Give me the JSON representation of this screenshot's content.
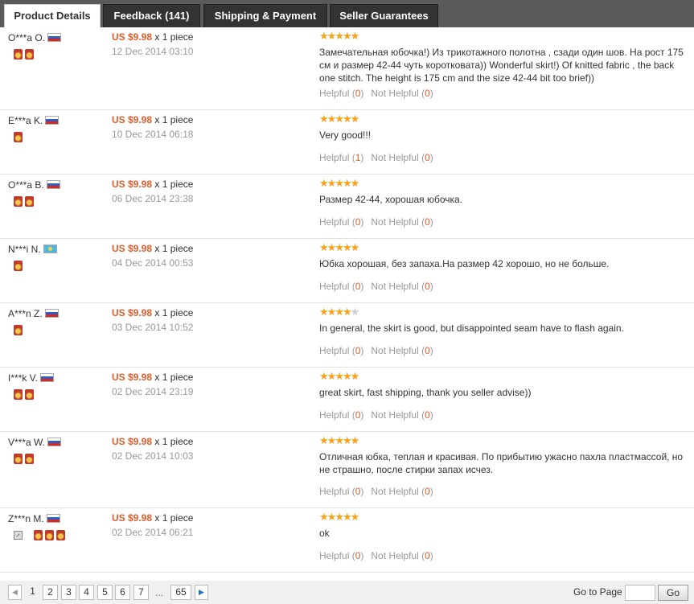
{
  "tabs": [
    {
      "label": "Product Details",
      "active": true
    },
    {
      "label": "Feedback (141)",
      "active": false
    },
    {
      "label": "Shipping & Payment",
      "active": false
    },
    {
      "label": "Seller Guarantees",
      "active": false
    }
  ],
  "reviews": [
    {
      "buyer": "O***a O.",
      "flag": "ru",
      "medals": 2,
      "vip": false,
      "price": "US $9.98",
      "qty": "x 1 piece",
      "date": "12 Dec 2014 03:10",
      "stars": 5,
      "comment": "Замечательная юбочка!) Из трикотажного полотна , сзади один шов. На рост 175 см и размер 42-44 чуть коротковата)) Wonderful skirt!) Of knitted fabric , the back one stitch. The height is 175 cm and the size 42-44 bit too brief))",
      "helpful_label": "Helpful",
      "helpful": "0",
      "not_helpful_label": "Not Helpful",
      "not_helpful": "0"
    },
    {
      "buyer": "E***a K.",
      "flag": "ru",
      "medals": 1,
      "vip": false,
      "price": "US $9.98",
      "qty": "x 1 piece",
      "date": "10 Dec 2014 06:18",
      "stars": 5,
      "comment": "Very good!!!",
      "helpful_label": "Helpful",
      "helpful": "1",
      "not_helpful_label": "Not Helpful",
      "not_helpful": "0"
    },
    {
      "buyer": "O***a B.",
      "flag": "ru",
      "medals": 2,
      "vip": false,
      "price": "US $9.98",
      "qty": "x 1 piece",
      "date": "06 Dec 2014 23:38",
      "stars": 5,
      "comment": "Размер 42-44, хорошая юбочка.",
      "helpful_label": "Helpful",
      "helpful": "0",
      "not_helpful_label": "Not Helpful",
      "not_helpful": "0"
    },
    {
      "buyer": "N***i N.",
      "flag": "kz",
      "medals": 1,
      "vip": false,
      "price": "US $9.98",
      "qty": "x 1 piece",
      "date": "04 Dec 2014 00:53",
      "stars": 5,
      "comment": "Юбка хорошая, без запаха.На размер 42 хорошо, но не больше.",
      "helpful_label": "Helpful",
      "helpful": "0",
      "not_helpful_label": "Not Helpful",
      "not_helpful": "0"
    },
    {
      "buyer": "A***n Z.",
      "flag": "ru",
      "medals": 1,
      "vip": false,
      "price": "US $9.98",
      "qty": "x 1 piece",
      "date": "03 Dec 2014 10:52",
      "stars": 4,
      "comment": "In general, the skirt is good, but disappointed seam have to flash again.",
      "helpful_label": "Helpful",
      "helpful": "0",
      "not_helpful_label": "Not Helpful",
      "not_helpful": "0"
    },
    {
      "buyer": "I***k V.",
      "flag": "ru",
      "medals": 2,
      "vip": false,
      "price": "US $9.98",
      "qty": "x 1 piece",
      "date": "02 Dec 2014 23:19",
      "stars": 5,
      "comment": "great skirt, fast shipping, thank you seller advise))",
      "helpful_label": "Helpful",
      "helpful": "0",
      "not_helpful_label": "Not Helpful",
      "not_helpful": "0"
    },
    {
      "buyer": "V***a W.",
      "flag": "ru",
      "medals": 2,
      "vip": false,
      "price": "US $9.98",
      "qty": "x 1 piece",
      "date": "02 Dec 2014 10:03",
      "stars": 5,
      "comment": "Отличная юбка, теплая и красивая. По прибытию ужасно пахла пластмассой, но не страшно, после стирки запах исчез.",
      "helpful_label": "Helpful",
      "helpful": "0",
      "not_helpful_label": "Not Helpful",
      "not_helpful": "0"
    },
    {
      "buyer": "Z***n M.",
      "flag": "ru",
      "medals": 3,
      "vip": true,
      "price": "US $9.98",
      "qty": "x 1 piece",
      "date": "02 Dec 2014 06:21",
      "stars": 5,
      "comment": "ok",
      "helpful_label": "Helpful",
      "helpful": "0",
      "not_helpful_label": "Not Helpful",
      "not_helpful": "0"
    }
  ],
  "pagination": {
    "prev": "◀",
    "next": "▶",
    "pages": [
      "1",
      "2",
      "3",
      "4",
      "5",
      "6",
      "7"
    ],
    "ellipsis": "...",
    "last": "65",
    "current": "1",
    "goto_label": "Go to Page",
    "goto_value": "",
    "go_button": "Go"
  },
  "colors": {
    "price": "#e05d2b",
    "star": "#f7a21b",
    "tabbar": "#5a5a5a"
  }
}
